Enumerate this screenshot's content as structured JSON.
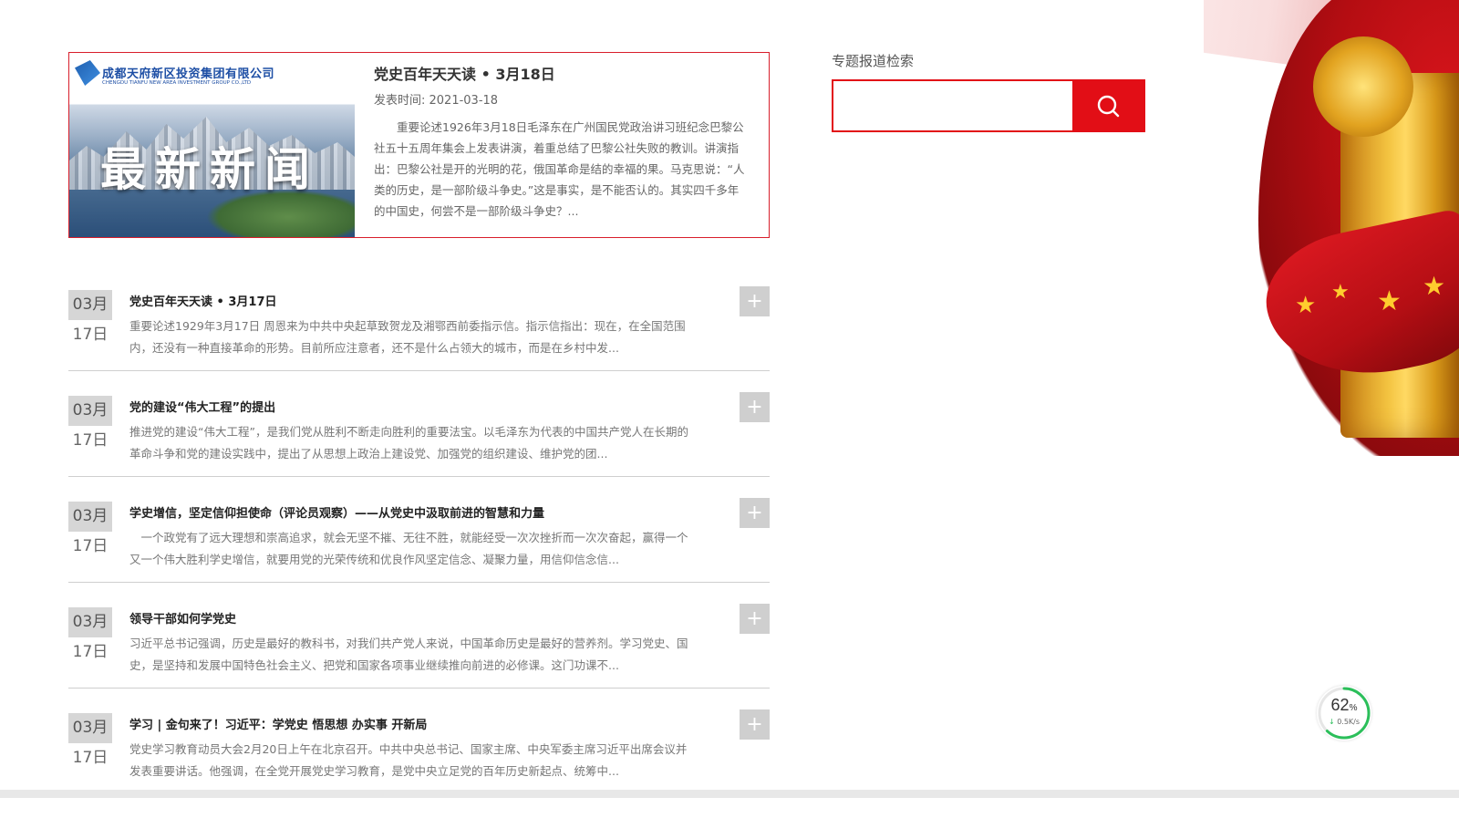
{
  "featured": {
    "logo_cn": "成都天府新区投资集团有限公司",
    "logo_en": "CHENGDU TIANFU NEW AREA INVESTMENT GROUP CO.,LTD",
    "banner_text": "最新新闻",
    "title": "党史百年天天读 • 3月18日",
    "date": "发表时间: 2021-03-18",
    "summary": "重要论述1926年3月18日毛泽东在广州国民党政治讲习班纪念巴黎公社五十五周年集会上发表讲演，着重总结了巴黎公社失败的教训。讲演指出：巴黎公社是开的光明的花，俄国革命是结的幸福的果。马克思说：“人类的历史，是一部阶级斗争史。”这是事实，是不能否认的。其实四千多年的中国史，何尝不是一部阶级斗争史？..."
  },
  "search": {
    "label": "专题报道检索",
    "placeholder": "",
    "icon": "search-icon",
    "accent": "#e20e16"
  },
  "list": [
    {
      "month": "03月",
      "day": "17日",
      "title": "党史百年天天读 • 3月17日",
      "summary": "重要论述1929年3月17日 周恩来为中共中央起草致贺龙及湘鄂西前委指示信。指示信指出：现在，在全国范围内，还没有一种直接革命的形势。目前所应注意者，还不是什么占领大的城市，而是在乡村中发..."
    },
    {
      "month": "03月",
      "day": "17日",
      "title": "党的建设“伟大工程”的提出",
      "summary": "推进党的建设“伟大工程”，是我们党从胜利不断走向胜利的重要法宝。以毛泽东为代表的中国共产党人在长期的革命斗争和党的建设实践中，提出了从思想上政治上建设党、加强党的组织建设、维护党的团..."
    },
    {
      "month": "03月",
      "day": "17日",
      "title": "学史增信，坚定信仰担使命（评论员观察）——从党史中汲取前进的智慧和力量",
      "summary": "一个政党有了远大理想和崇高追求，就会无坚不摧、无往不胜，就能经受一次次挫折而一次次奋起，赢得一个又一个伟大胜利学史增信，就要用党的光荣传统和优良作风坚定信念、凝聚力量，用信仰信念信..."
    },
    {
      "month": "03月",
      "day": "17日",
      "title": "领导干部如何学党史",
      "summary": "习近平总书记强调，历史是最好的教科书，对我们共产党人来说，中国革命历史是最好的营养剂。学习党史、国史，是坚持和发展中国特色社会主义、把党和国家各项事业继续推向前进的必修课。这门功课不..."
    },
    {
      "month": "03月",
      "day": "17日",
      "title": "学习 | 金句来了！习近平：学党史 悟思想 办实事 开新局",
      "summary": "党史学习教育动员大会2月20日上午在北京召开。中共中央总书记、国家主席、中央军委主席习近平出席会议并发表重要讲话。他强调，在全党开展党史学习教育，是党中央立足党的百年历史新起点、统筹中..."
    }
  ],
  "plus_label": "+",
  "network_widget": {
    "percent": "62",
    "percent_sign": "%",
    "percent_value": 0.62,
    "speed": "0.5K/s",
    "arrow": "↓",
    "ring_color": "#2bbf5a"
  }
}
